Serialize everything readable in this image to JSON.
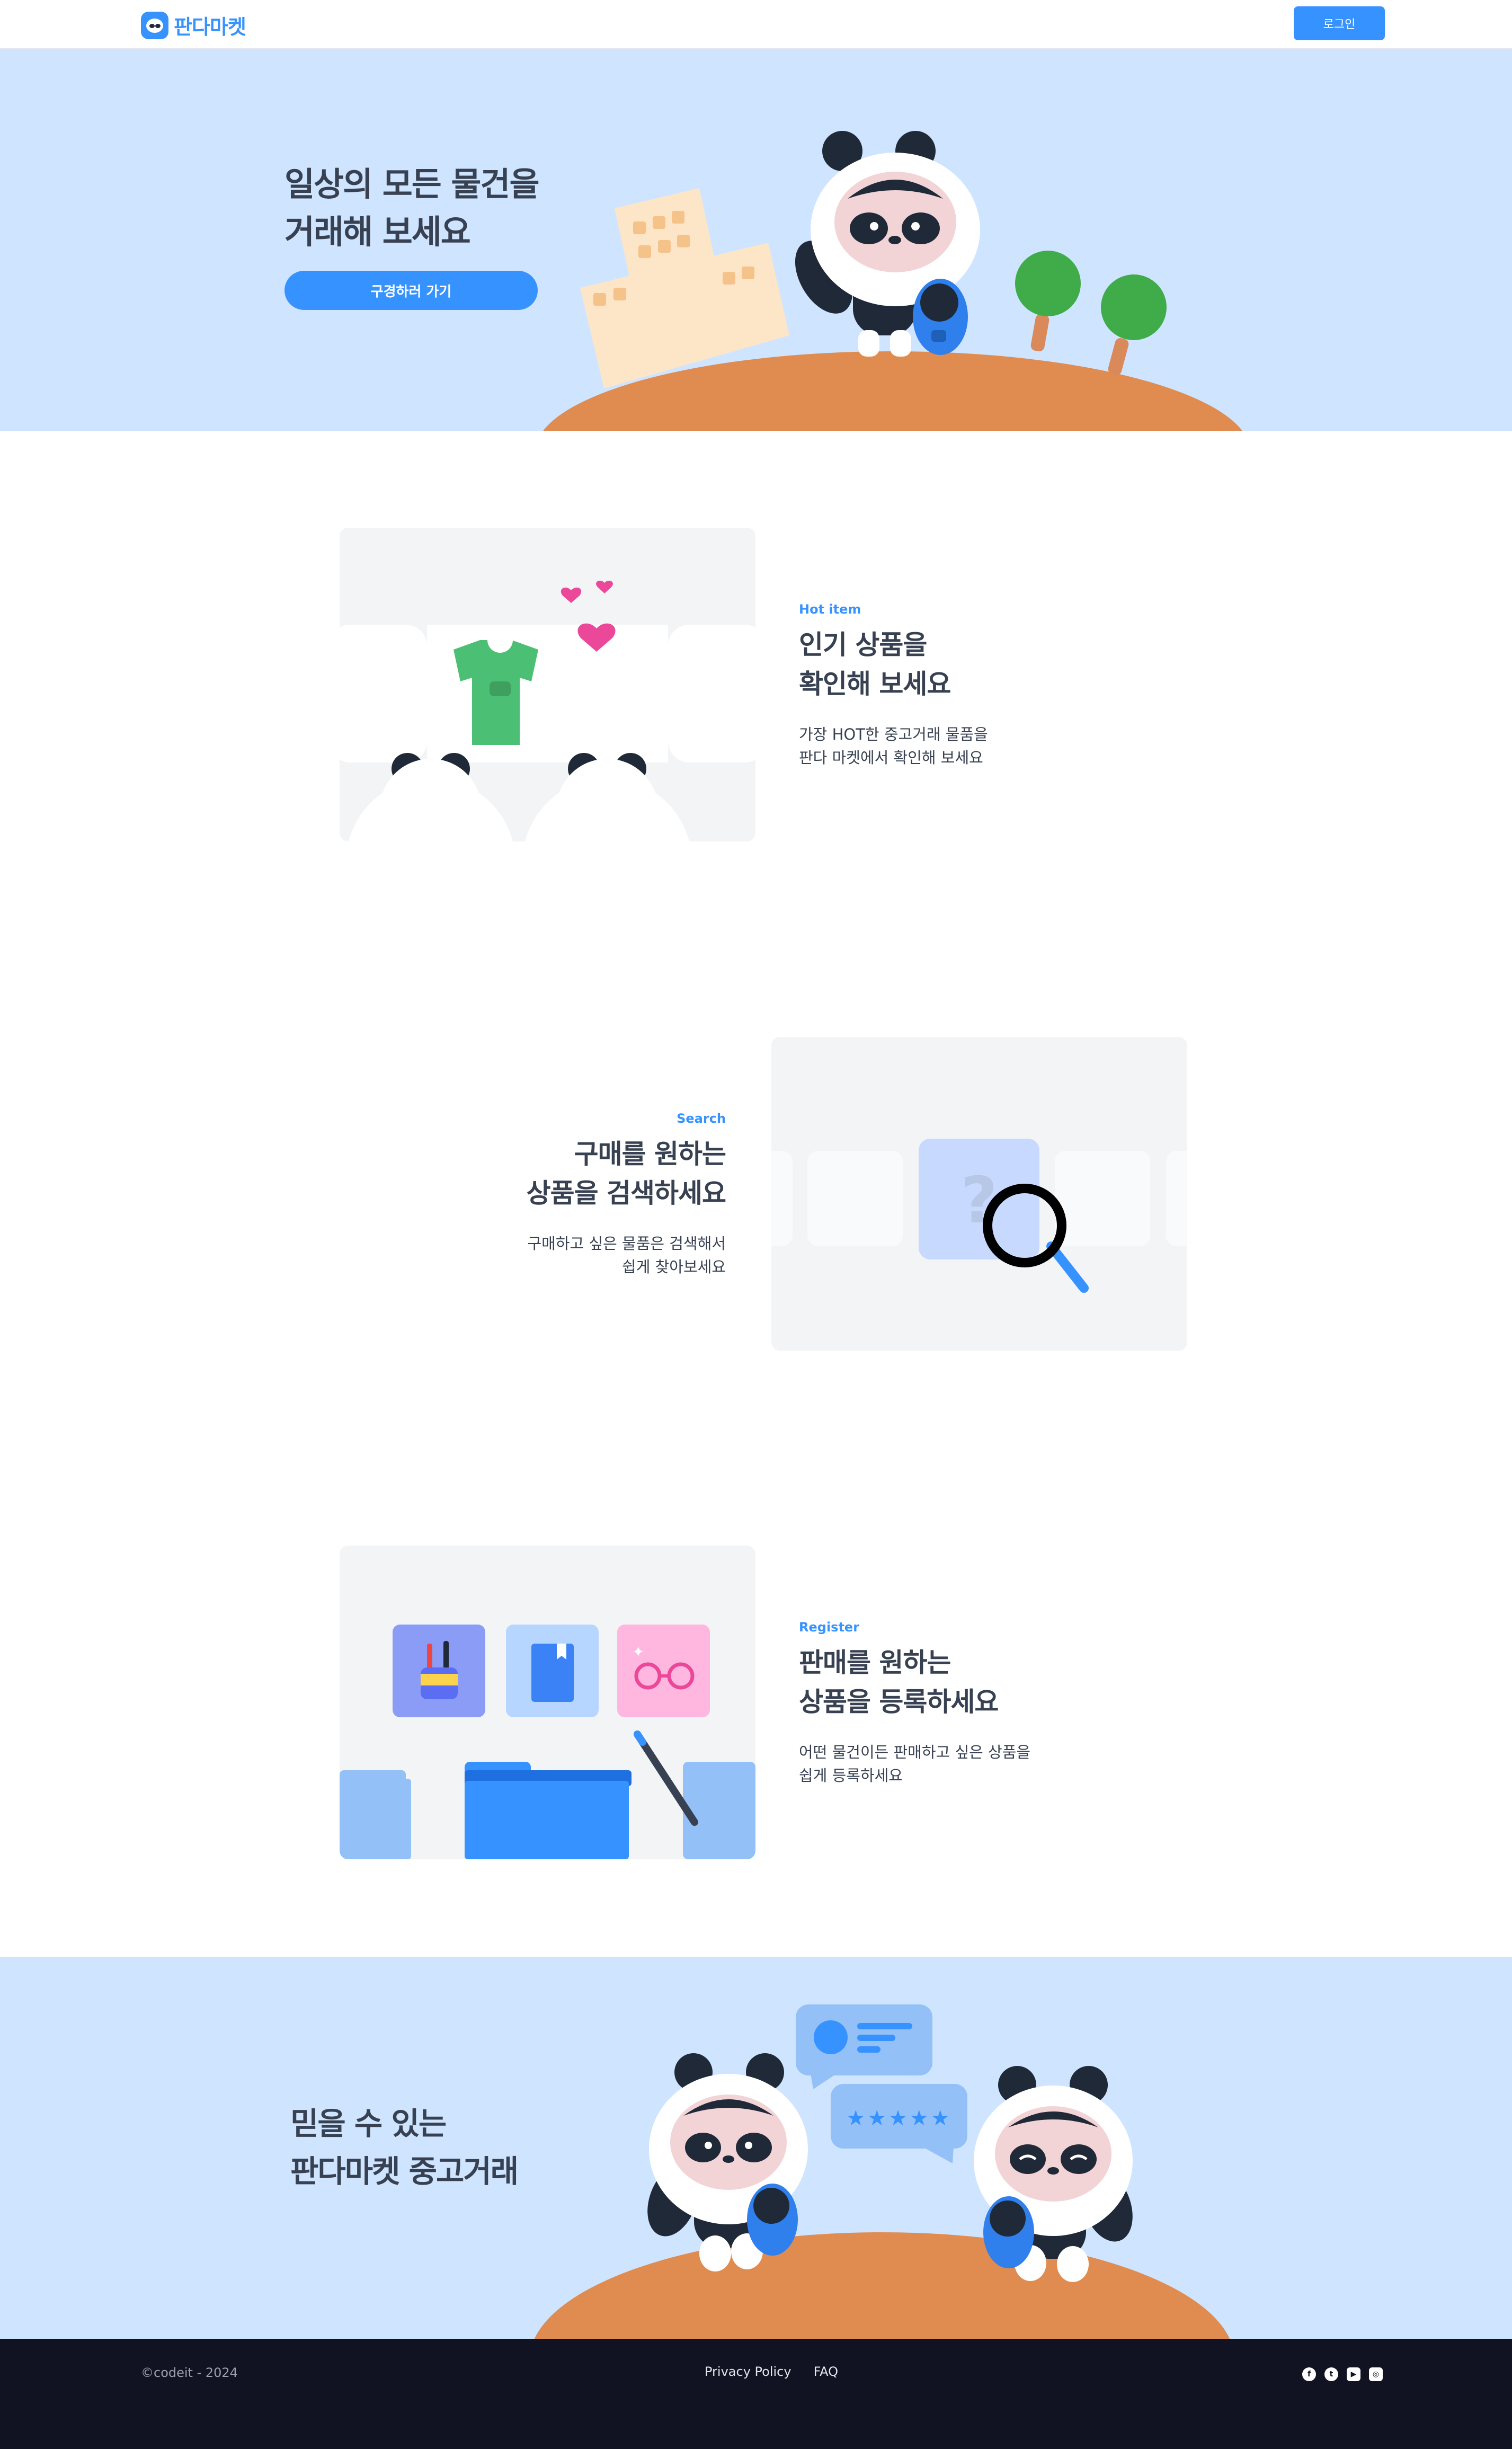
{
  "header": {
    "brand": "판다마켓",
    "login_label": "로그인"
  },
  "hero": {
    "title_line1": "일상의 모든 물건을",
    "title_line2": "거래해 보세요",
    "cta_label": "구경하러 가기"
  },
  "features": [
    {
      "tag": "Hot item",
      "title_line1": "인기 상품을",
      "title_line2": "확인해 보세요",
      "desc_line1": "가장 HOT한 중고거래 물품을",
      "desc_line2": "판다 마켓에서 확인해 보세요"
    },
    {
      "tag": "Search",
      "title_line1": "구매를 원하는",
      "title_line2": "상품을 검색하세요",
      "desc_line1": "구매하고 싶은 물품은 검색해서",
      "desc_line2": "쉽게 찾아보세요"
    },
    {
      "tag": "Register",
      "title_line1": "판매를 원하는",
      "title_line2": "상품을 등록하세요",
      "desc_line1": "어떤 물건이든 판매하고 싶은 상품을",
      "desc_line2": "쉽게 등록하세요"
    }
  ],
  "trust": {
    "title_line1": "믿을 수 있는",
    "title_line2": "판다마켓 중고거래"
  },
  "footer": {
    "copyright": "©codeit - 2024",
    "links": [
      "Privacy Policy",
      "FAQ"
    ],
    "socials": [
      "facebook-icon",
      "twitter-icon",
      "youtube-icon",
      "instagram-icon"
    ]
  },
  "colors": {
    "brand": "#3692ff",
    "hero_bg": "#cfe5ff",
    "footer_bg": "#111322",
    "ground": "#e08b4f"
  }
}
